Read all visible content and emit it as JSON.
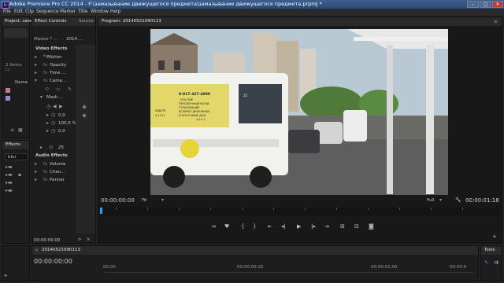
{
  "titlebar": {
    "app_icon": "Pr",
    "title": "Adobe Premiere Pro CC 2014 - F:\\замазывание движущегося предмета\\замазывание движущегося предмета.prproj *",
    "min_icon": "minimize-icon",
    "max_icon": "maximize-icon",
    "close_icon": "close-icon"
  },
  "menu": [
    "File",
    "Edit",
    "Clip",
    "Sequence",
    "Marker",
    "Title",
    "Window",
    "Help"
  ],
  "project_panel": {
    "tab": "Project: замазыв",
    "items_count": "2 Items",
    "column": "Name"
  },
  "effects_panel": {
    "tab": "Effects",
    "search_value": "blur"
  },
  "effect_controls": {
    "tabs": [
      "Effect Controls",
      "Source"
    ],
    "master": "Master * ...",
    "seq": "2014 ...",
    "sections": {
      "video": "Video Effects",
      "audio": "Audio Effects"
    },
    "rows": {
      "motion": "Motion",
      "opacity": "Opacity",
      "time": "Time ...",
      "camera": "Came...",
      "mask": "Mask ...",
      "mask_v1": "0,0",
      "mask_v2": "100,0 %",
      "mask_v3": "0,0",
      "blur_val": "25",
      "volume": "Volume",
      "channel": "Chan...",
      "panner": "Panner"
    },
    "timecode": "00:00:00:00"
  },
  "program_monitor": {
    "tab": "Program: 20140521090113",
    "timecode_left": "00:00:00:00",
    "fit": "Fit",
    "quality": "Full",
    "timecode_right": "00:00:01:18",
    "video_text": {
      "phone": "8-917-427-4000",
      "ad_line1": "УЧАСТИЕ",
      "ad_line2": "ПЕНСИОННЫЙ ФОНД",
      "ad_line3": "СТРАХОВАНИЕ",
      "ad_line4": "ВОЗВРАТ ДЕНЕЖНЫХ",
      "ad_line5": "И ПОСОЧНЫЙ ДОК",
      "ad_line6": "4-11-1",
      "small_left1": "ЖДИТЕ",
      "small_left2": "4-1111",
      "window_num": "25"
    }
  },
  "timeline": {
    "tab": "20140521090113",
    "timecode": "00:00:00:00",
    "ruler": [
      "00:00",
      "00:00:00:25",
      "00:00:01:00",
      "00:00:0"
    ]
  },
  "tools_panel": {
    "tab": "Tools"
  },
  "colors": {
    "accent": "#2f9bff",
    "titlebar": "#2a4a78",
    "panel": "#1d1d1d"
  }
}
